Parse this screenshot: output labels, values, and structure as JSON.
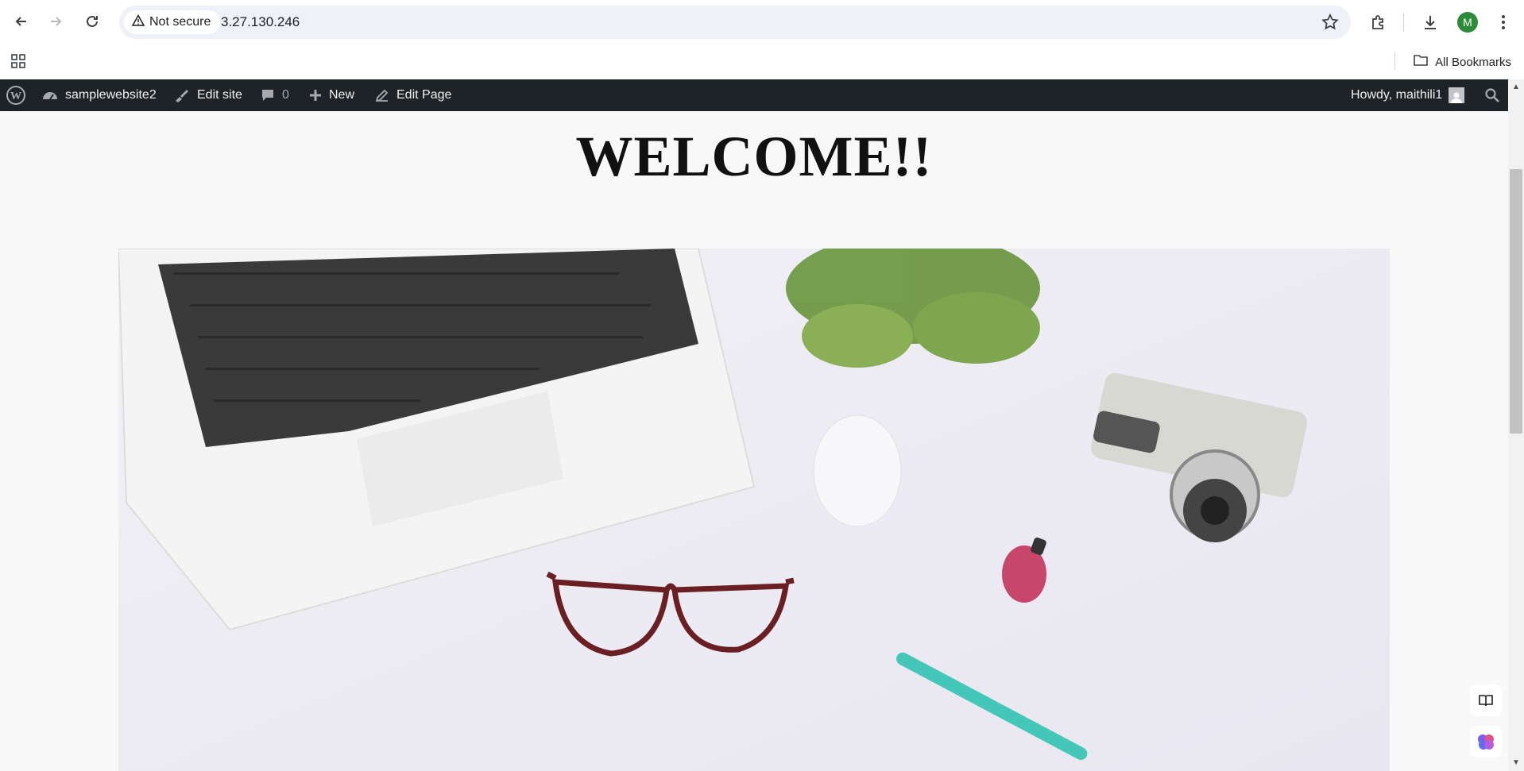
{
  "browser": {
    "security_label": "Not secure",
    "url": "3.27.130.246",
    "profile_initial": "M",
    "all_bookmarks": "All Bookmarks"
  },
  "admin_bar": {
    "site_name": "samplewebsite2",
    "edit_site": "Edit site",
    "comments_count": "0",
    "new_label": "New",
    "edit_page": "Edit Page",
    "howdy": "Howdy, maithili1"
  },
  "page": {
    "heading": "WELCOME!!"
  },
  "icons": {
    "back": "back-arrow-icon",
    "forward": "forward-arrow-icon",
    "reload": "reload-icon",
    "warning": "warning-icon",
    "star": "star-icon",
    "extensions": "puzzle-icon",
    "download": "download-icon",
    "menu": "kebab-menu-icon",
    "apps": "apps-grid-icon",
    "folder": "folder-icon",
    "wordpress": "wordpress-logo-icon",
    "dashboard": "dashboard-icon",
    "brush": "brush-icon",
    "comment": "comment-icon",
    "plus": "plus-icon",
    "pencil": "pencil-icon",
    "search": "search-icon",
    "reading": "reading-mode-icon",
    "ai": "brain-icon"
  },
  "colors": {
    "admin_bar_bg": "#1d2327",
    "profile_green": "#2e8b3a",
    "page_bg": "#f8f8f8"
  }
}
